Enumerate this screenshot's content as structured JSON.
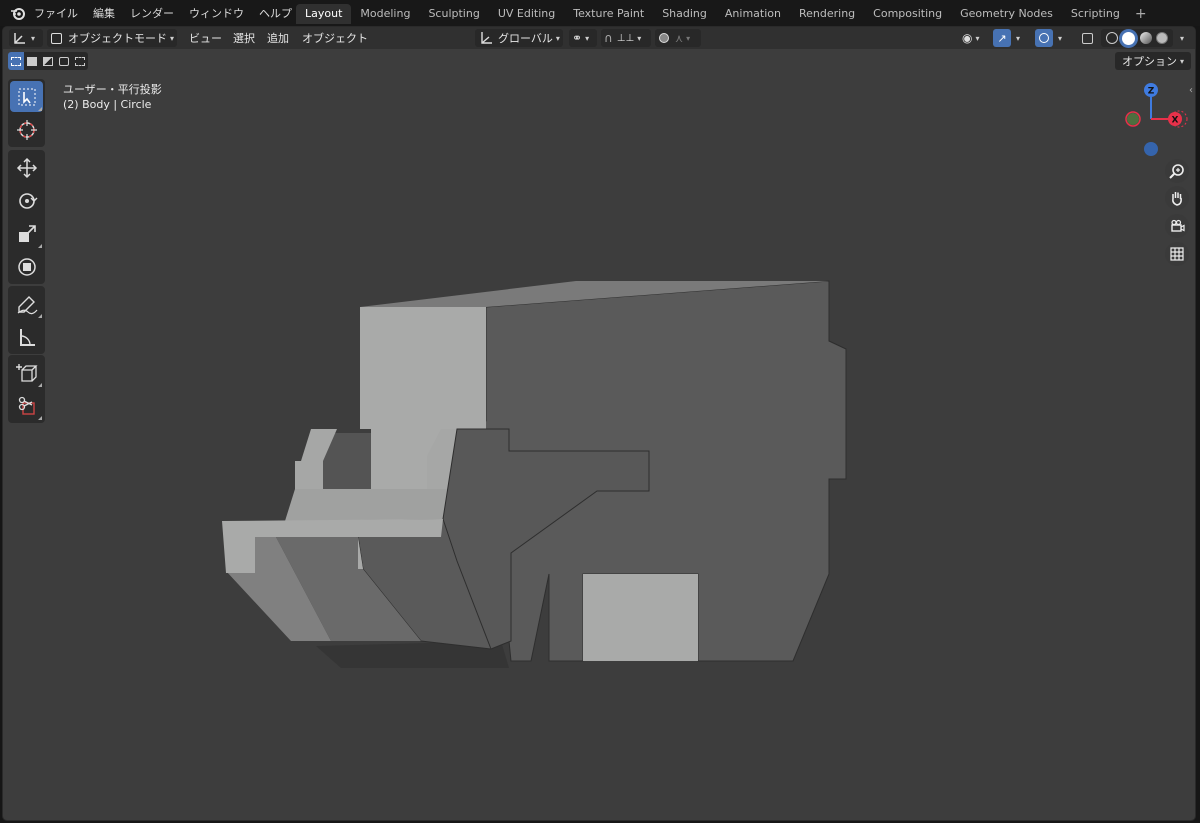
{
  "menu": [
    "ファイル",
    "編集",
    "レンダー",
    "ウィンドウ",
    "ヘルプ"
  ],
  "workspaces": [
    "Layout",
    "Modeling",
    "Sculpting",
    "UV Editing",
    "Texture Paint",
    "Shading",
    "Animation",
    "Rendering",
    "Compositing",
    "Geometry Nodes",
    "Scripting"
  ],
  "active_workspace": "Layout",
  "header": {
    "mode": "オブジェクトモード",
    "menus": [
      "ビュー",
      "選択",
      "追加",
      "オブジェクト"
    ],
    "transform_orientation": "グローバル"
  },
  "options_label": "オプション",
  "viewport": {
    "view_name": "ユーザー・平行投影",
    "object_info": "(2) Body | Circle"
  },
  "gizmo": {
    "z_label": "Z",
    "x_label": "X"
  },
  "colors": {
    "accent": "#4772b3",
    "axis_x": "#e8314a",
    "axis_z": "#3f7be0",
    "axis_y": "#5e9944"
  },
  "icons": [
    "blender-logo",
    "select-box-icon",
    "cursor-icon",
    "move-icon",
    "rotate-icon",
    "scale-icon",
    "transform-icon",
    "annotate-icon",
    "measure-icon",
    "add-cube-icon",
    "shear-icon",
    "zoom-icon",
    "hand-icon",
    "camera-icon",
    "grid-icon"
  ]
}
